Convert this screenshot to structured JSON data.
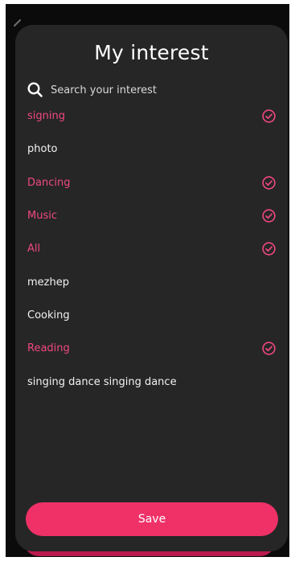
{
  "header": {
    "title": "My interest",
    "back_icon": "chevron-left-icon"
  },
  "search": {
    "placeholder": "Search your interest",
    "icon": "search-icon"
  },
  "interests": [
    {
      "label": "signing",
      "selected": true
    },
    {
      "label": "photo",
      "selected": false
    },
    {
      "label": "Dancing",
      "selected": true
    },
    {
      "label": "Music",
      "selected": true
    },
    {
      "label": "All",
      "selected": true
    },
    {
      "label": "mezhep",
      "selected": false
    },
    {
      "label": "Cooking",
      "selected": false
    },
    {
      "label": "Reading",
      "selected": true
    },
    {
      "label": "singing dance singing dance",
      "selected": false
    }
  ],
  "footer": {
    "save_label": "Save"
  },
  "colors": {
    "accent": "#ef3168",
    "selected_text": "#f04880",
    "sheet_bg": "#262626",
    "page_bg": "#0b0b0b"
  }
}
